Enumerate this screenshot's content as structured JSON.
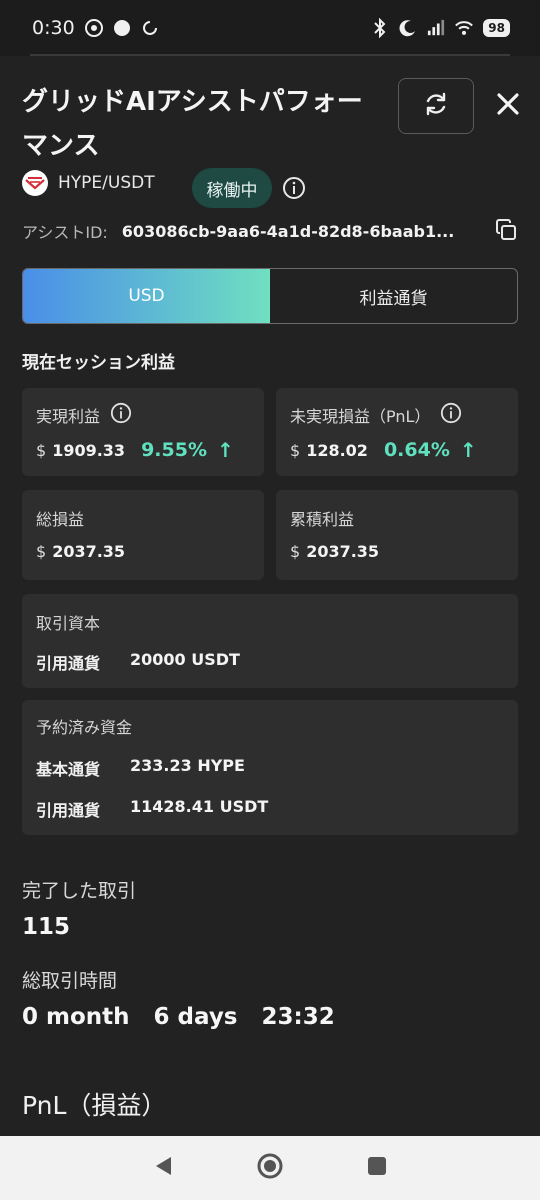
{
  "status_bar": {
    "time": "0:30",
    "battery": "98",
    "left_icons": [
      "chrome-icon",
      "circle-icon",
      "data-saver-icon"
    ],
    "right_icons": [
      "bluetooth-icon",
      "do-not-disturb-icon",
      "signal-icon",
      "wifi-icon"
    ]
  },
  "header": {
    "title": "グリッドAIアシストパフォーマンス",
    "pair": "HYPE/USDT",
    "status": "稼働中",
    "assist_id_label": "アシストID:",
    "assist_id_value": "603086cb-9aa6-4a1d-82d8-6baab1..."
  },
  "segment": {
    "options": [
      "USD",
      "利益通貨"
    ],
    "selected": "USD"
  },
  "session": {
    "title": "現在セッション利益",
    "realized": {
      "label": "実現利益",
      "currency": "$",
      "value": "1909.33",
      "pct": "9.55%"
    },
    "unrealized": {
      "label": "未実現損益（PnL）",
      "currency": "$",
      "value": "128.02",
      "pct": "0.64%"
    },
    "total": {
      "label": "総損益",
      "currency": "$",
      "value": "2037.35"
    },
    "cumulative": {
      "label": "累積利益",
      "currency": "$",
      "value": "2037.35"
    }
  },
  "capital": {
    "label": "取引資本",
    "quote_key": "引用通貨",
    "quote_value": "20000 USDT"
  },
  "reserved": {
    "label": "予約済み資金",
    "base_key": "基本通貨",
    "base_value": "233.23 HYPE",
    "quote_key": "引用通貨",
    "quote_value": "11428.41 USDT"
  },
  "stats": {
    "completed_label": "完了した取引",
    "completed_value": "115",
    "duration_label": "総取引時間",
    "duration_months": "0 month",
    "duration_days": "6 days",
    "duration_time": "23:32"
  },
  "pnl_heading": "PnL（損益）",
  "colors": {
    "accent_green": "#5fe0be",
    "badge_bg": "#1f4a44",
    "gradient_start": "#4a8ee8",
    "gradient_end": "#6fe0c0"
  }
}
